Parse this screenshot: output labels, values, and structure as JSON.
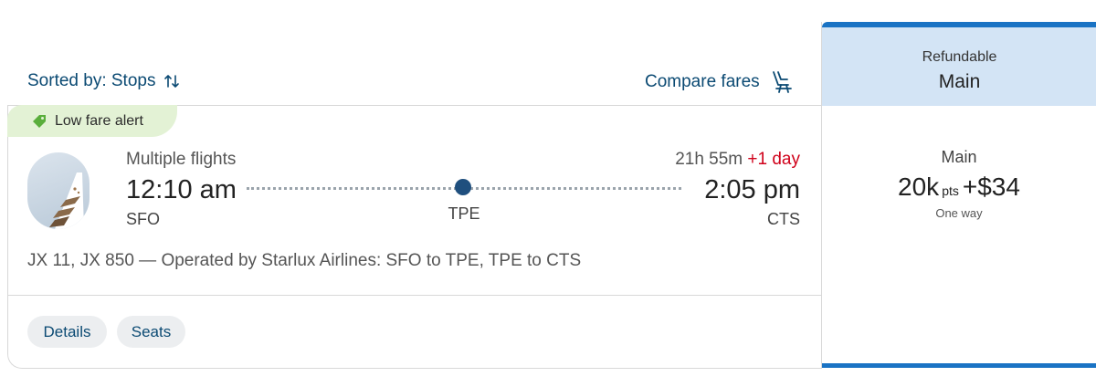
{
  "toolbar": {
    "sorted_label": "Sorted by: Stops",
    "compare_label": "Compare fares"
  },
  "flight": {
    "alert_label": "Low fare alert",
    "type_label": "Multiple flights",
    "departure_time": "12:10 am",
    "departure_code": "SFO",
    "stop_code": "TPE",
    "duration": "21h 55m",
    "day_offset": "+1 day",
    "arrival_time": "2:05 pm",
    "arrival_code": "CTS",
    "operated_by": "JX 11, JX 850 — Operated by Starlux Airlines: SFO to TPE, TPE to CTS",
    "details_label": "Details",
    "seats_label": "Seats"
  },
  "fare": {
    "header_refund": "Refundable",
    "header_cabin": "Main",
    "fare_name": "Main",
    "points": "20k",
    "points_unit": "pts",
    "plus": "+",
    "cash": "$34",
    "trip_type": "One way"
  },
  "colors": {
    "link": "#0b4a73",
    "accent_blue": "#1a73c4",
    "alert_green": "#e3f2d5",
    "day_offset_red": "#d0021b"
  },
  "icons": {
    "sort": "sort-arrows-icon",
    "compare": "seat-icon",
    "alert": "tag-icon",
    "logo": "starlux-logo"
  }
}
